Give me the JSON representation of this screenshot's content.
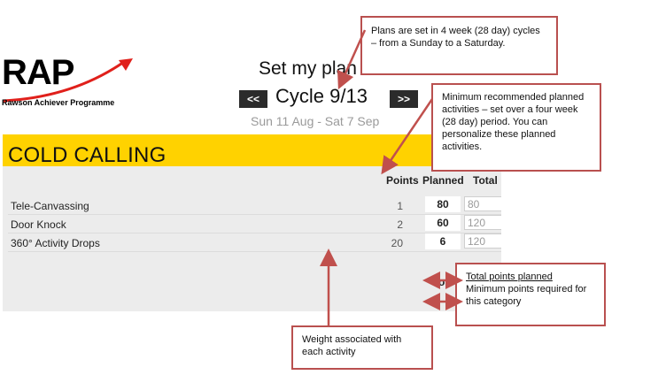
{
  "logo": {
    "text": "RAP",
    "subtitle": "Rawson Achiever Programme"
  },
  "header": {
    "title": "Set my plan",
    "prev_label": "<<",
    "next_label": ">>",
    "cycle": "Cycle 9/13",
    "date_range": "Sun 11 Aug - Sat 7 Sep"
  },
  "category": {
    "title": "COLD CALLING",
    "columns": {
      "points": "Points",
      "planned": "Planned",
      "total": "Total"
    },
    "activities": [
      {
        "name": "Tele-Canvassing",
        "points": "1",
        "planned": "80",
        "total": "80"
      },
      {
        "name": "Door Knock",
        "points": "2",
        "planned": "60",
        "total": "120"
      },
      {
        "name": "360° Activity Drops",
        "points": "20",
        "planned": "6",
        "total": "120"
      }
    ],
    "total_label_fragment": "ou"
  },
  "callouts": {
    "cycle_info": "Plans are set in 4 week (28 day) cycles – from a Sunday to a Saturday.",
    "min_activities": "Minimum recommended planned activities – set over a four week (28 day) period. You can personalize these planned activities.",
    "total_points": "Total points planned",
    "min_points": "Minimum points required for this category",
    "weight": "Weight associated with each activity"
  },
  "colors": {
    "category_header": "#ffd200",
    "panel_bg": "#ececec",
    "callout_border": "#b9504f",
    "logo_swoosh": "#e0201b"
  }
}
